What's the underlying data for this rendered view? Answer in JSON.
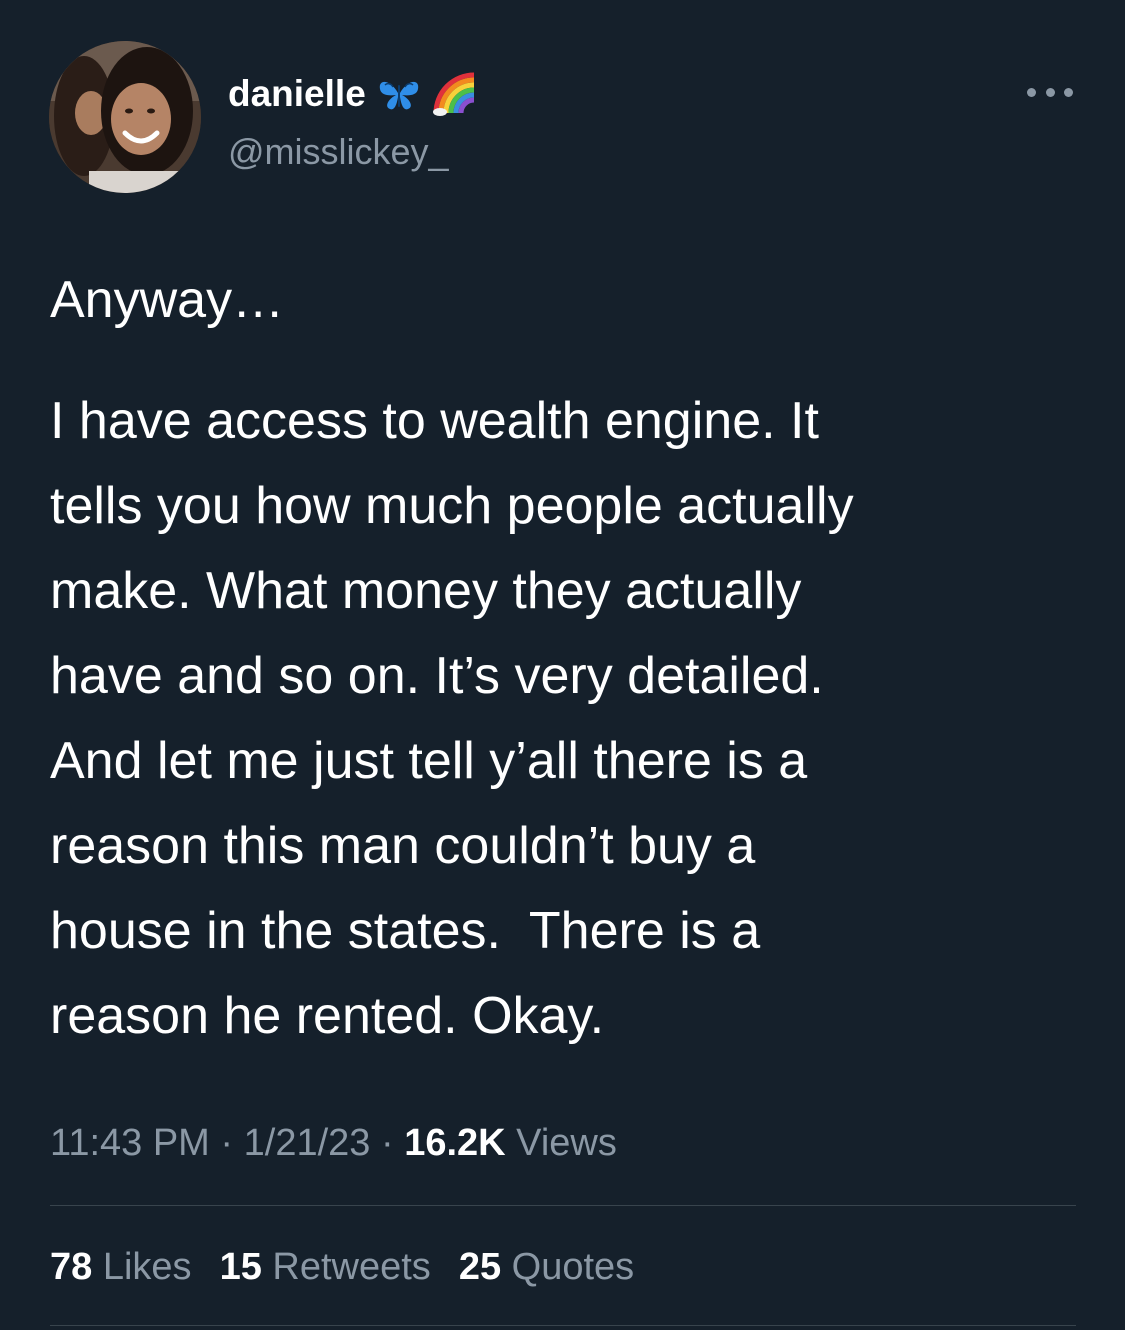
{
  "author": {
    "display_name": "danielle",
    "handle": "@misslickey_",
    "name_emojis": [
      "butterfly-icon",
      "rainbow-icon"
    ]
  },
  "tweet": {
    "paragraph1": "Anyway…",
    "paragraph2_lines": [
      "I have access to wealth engine. It",
      "tells you how much people actually",
      "make. What money they actually",
      "have and so on. It’s very detailed.",
      "And let me just tell y’all there is a",
      "reason this man couldn’t buy a",
      "house in the states.  There is a",
      "reason he rented. Okay."
    ]
  },
  "meta": {
    "time": "11:43 PM",
    "sep1": " · ",
    "date": "1/21/23",
    "sep2": " · ",
    "views_count": "16.2K",
    "views_label": " Views"
  },
  "stats": {
    "likes_count": "78",
    "likes_label": "Likes",
    "retweets_count": "15",
    "retweets_label": "Retweets",
    "quotes_count": "25",
    "quotes_label": "Quotes"
  },
  "colors": {
    "background": "#15202b",
    "text_primary": "#ffffff",
    "text_secondary": "#8b98a5",
    "divider": "#38444d",
    "butterfly": "#2f8ee8"
  }
}
